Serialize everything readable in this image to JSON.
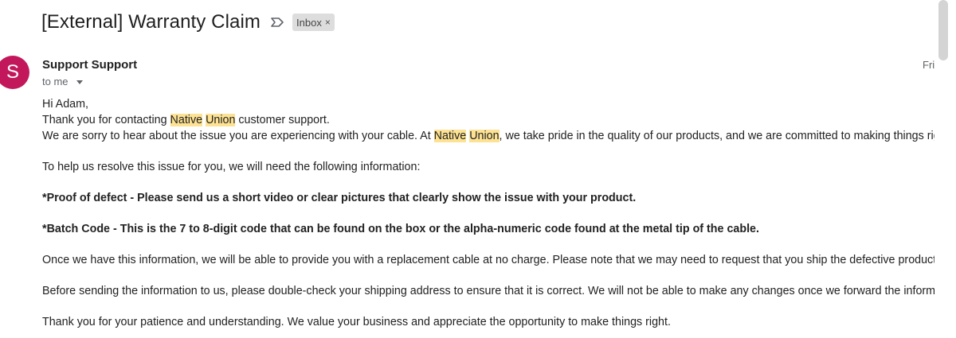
{
  "email": {
    "subject": "[External] Warranty Claim",
    "label_chip": "Inbox",
    "label_close": "×",
    "sender_initial": "S",
    "sender_name": "Support Support",
    "recipient": "to me",
    "date": "Fri"
  },
  "body": {
    "greeting": "Hi Adam,",
    "line1_a": "Thank you for contacting ",
    "brand_word1": "Native",
    "brand_space": " ",
    "brand_word2": "Union",
    "line1_b": " customer support.",
    "line2_a": "We are sorry to hear about the issue you are experiencing with your cable. At ",
    "line2_b": ", we take pride in the quality of our products, and we are committed to making things right for our",
    "line3": "To help us resolve this issue for you, we will need the following information:",
    "req1": "*Proof of defect - Please send us a short video or clear pictures that clearly show the issue with your product.",
    "req2": "*Batch Code - This is the 7 to 8-digit code that can be found on the box or the alpha-numeric code found at the metal tip of the cable.",
    "para1": "Once we have this information, we will be able to provide you with a replacement cable at no charge. Please note that we may need to request that you ship the defective product back to us",
    "para2": "Before sending the information to us, please double-check your shipping address to ensure that it is correct. We will not be able to make any changes once we forward the information to our",
    "para3": "Thank you for your patience and understanding. We value your business and appreciate the opportunity to make things right."
  },
  "colors": {
    "avatar": "#c2185b",
    "highlight": "#fde293",
    "chip": "#dddddd"
  },
  "icons": {
    "important": "important-marker-icon",
    "caret": "caret-down-icon"
  }
}
